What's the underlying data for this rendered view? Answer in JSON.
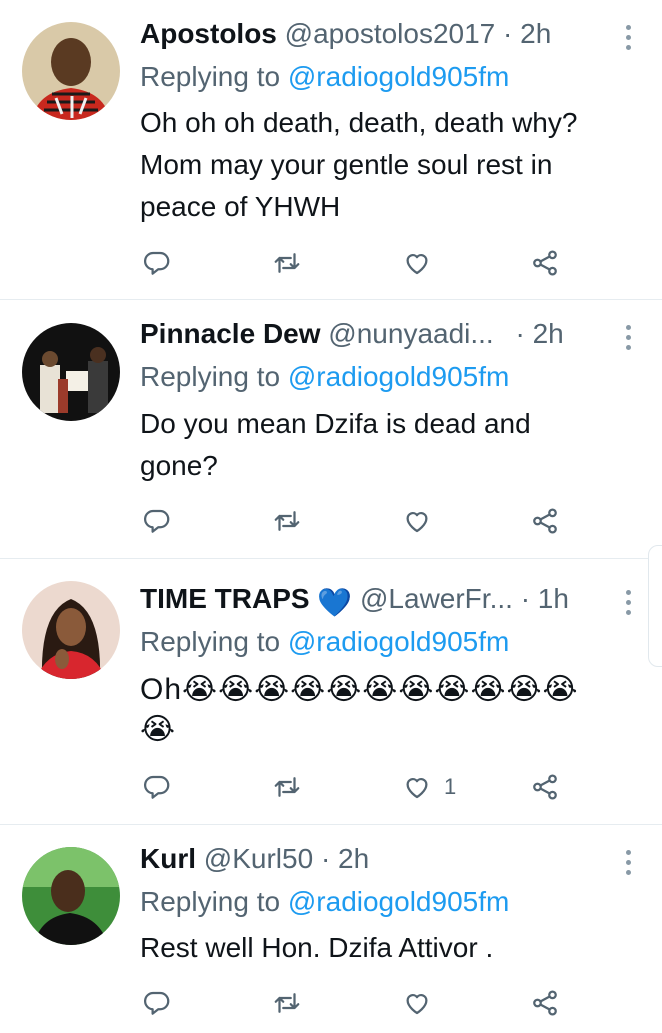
{
  "tweets": [
    {
      "name": "Apostolos",
      "handle": "@apostolos2017",
      "separator": "·",
      "time": "2h",
      "replying_prefix": "Replying to",
      "replying_to": "@radiogold905fm",
      "text_lines": [
        "Oh oh oh death, death, death why?",
        "Mom may your gentle soul rest in",
        "peace of YHWH"
      ],
      "like_count": ""
    },
    {
      "name": "Pinnacle Dew",
      "handle": "@nunyaadi...",
      "separator": "·",
      "time": "2h",
      "replying_prefix": "Replying to",
      "replying_to": "@radiogold905fm",
      "text_lines": [
        "Do you mean Dzifa is dead and",
        "gone?"
      ],
      "like_count": ""
    },
    {
      "name": "TIME TRAPS",
      "verified_badge": "💙",
      "handle": "@LawerFr...",
      "separator": "·",
      "time": "1h",
      "replying_prefix": "Replying to",
      "replying_to": "@radiogold905fm",
      "text_lines": [
        "Oh😭😭😭😭😭😭😭😭😭😭😭",
        "😭"
      ],
      "like_count": "1"
    },
    {
      "name": "Kurl",
      "handle": "@Kurl50",
      "separator": "·",
      "time": "2h",
      "replying_prefix": "Replying to",
      "replying_to": "@radiogold905fm",
      "text_lines": [
        "Rest well Hon. Dzifa Attivor ."
      ],
      "like_count": ""
    }
  ],
  "icons": {
    "reply": "reply-icon",
    "retweet": "retweet-icon",
    "like": "heart-icon",
    "share": "share-icon",
    "more": "more-icon"
  },
  "colors": {
    "link": "#1d9bf0",
    "secondary_text": "#536471",
    "divider": "#e6ecf0"
  }
}
